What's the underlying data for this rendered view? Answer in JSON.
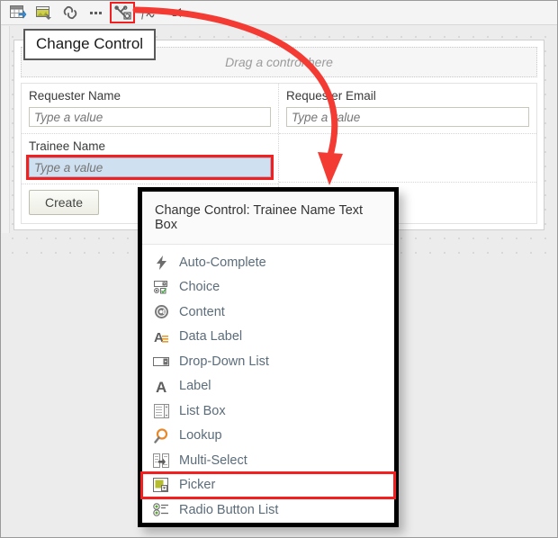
{
  "toolbar": {
    "buttons": [
      {
        "name": "insert-table-icon",
        "label": "Insert Table"
      },
      {
        "name": "insert-image-icon",
        "label": "Insert Image"
      },
      {
        "name": "link-icon",
        "label": "Link"
      },
      {
        "name": "more-options-icon",
        "label": "More"
      },
      {
        "name": "change-control-icon",
        "label": "Change Control"
      },
      {
        "name": "formula-icon",
        "label": "Formula"
      },
      {
        "name": "paint-icon",
        "label": "Paint"
      }
    ],
    "selected_button": "change-control-icon"
  },
  "tooltip": {
    "text": "Change Control"
  },
  "form": {
    "drop_zone_text": "Drag a control here",
    "fields": [
      {
        "label": "Requester Name",
        "placeholder": "Type a value",
        "value": "",
        "selected": false
      },
      {
        "label": "Requester Email",
        "placeholder": "Type a value",
        "value": "",
        "selected": false
      },
      {
        "label": "Trainee Name",
        "placeholder": "Type a value",
        "value": "",
        "selected": true
      }
    ],
    "submit_label": "Create"
  },
  "popup": {
    "title": "Change Control: Trainee Name Text Box",
    "selected_item": "Picker",
    "items": [
      {
        "label": "Auto-Complete",
        "icon": "lightning-bolt-icon"
      },
      {
        "label": "Choice",
        "icon": "choice-icon"
      },
      {
        "label": "Content",
        "icon": "content-at-icon"
      },
      {
        "label": "Data Label",
        "icon": "data-label-icon"
      },
      {
        "label": "Drop-Down List",
        "icon": "drop-down-list-icon"
      },
      {
        "label": "Label",
        "icon": "label-a-icon"
      },
      {
        "label": "List Box",
        "icon": "list-box-icon"
      },
      {
        "label": "Lookup",
        "icon": "lookup-magnifier-icon"
      },
      {
        "label": "Multi-Select",
        "icon": "multi-select-icon"
      },
      {
        "label": "Picker",
        "icon": "picker-icon"
      },
      {
        "label": "Radio Button List",
        "icon": "radio-button-list-icon"
      }
    ]
  },
  "annotation": {
    "arrow_color": "#f43b33",
    "highlight_color": "#f42020"
  }
}
